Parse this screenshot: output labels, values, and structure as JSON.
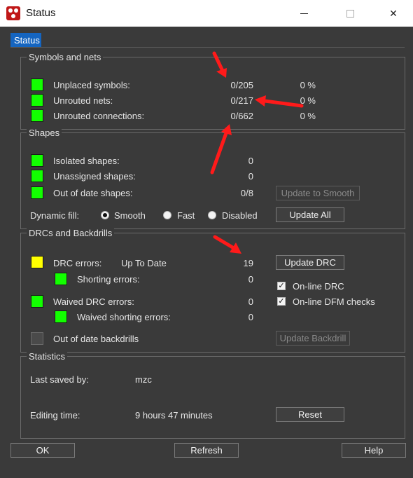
{
  "window": {
    "title": "Status"
  },
  "tabs": [
    {
      "label": "Status"
    }
  ],
  "symbols_and_nets": {
    "title": "Symbols and nets",
    "rows": [
      {
        "label": "Unplaced symbols:",
        "value": "0/205",
        "percent": "0 %"
      },
      {
        "label": "Unrouted nets:",
        "value": "0/217",
        "percent": "0 %"
      },
      {
        "label": "Unrouted connections:",
        "value": "0/662",
        "percent": "0 %"
      }
    ]
  },
  "shapes": {
    "title": "Shapes",
    "rows": [
      {
        "label": "Isolated shapes:",
        "value": "0"
      },
      {
        "label": "Unassigned shapes:",
        "value": "0"
      },
      {
        "label": "Out of date shapes:",
        "value": "0/8"
      }
    ],
    "update_to_smooth": "Update to Smooth",
    "dynamic_fill_label": "Dynamic fill:",
    "fill_options": [
      "Smooth",
      "Fast",
      "Disabled"
    ],
    "fill_selected": "Smooth",
    "update_all": "Update All"
  },
  "drcs": {
    "title": "DRCs and Backdrills",
    "drc_errors_label": "DRC errors:",
    "drc_status": "Up To Date",
    "drc_errors_value": "19",
    "shorting_errors_label": "Shorting errors:",
    "shorting_errors_value": "0",
    "waived_drc_label": "Waived DRC errors:",
    "waived_drc_value": "0",
    "waived_shorting_label": "Waived shorting errors:",
    "waived_shorting_value": "0",
    "out_of_date_backdrills_label": "Out of date backdrills",
    "update_drc": "Update DRC",
    "online_drc": "On-line DRC",
    "online_dfm": "On-line DFM checks",
    "update_backdrill": "Update Backdrill"
  },
  "statistics": {
    "title": "Statistics",
    "last_saved_label": "Last saved by:",
    "last_saved_value": "mzc",
    "editing_time_label": "Editing time:",
    "editing_time_value": "9 hours 47 minutes",
    "reset": "Reset"
  },
  "footer": {
    "ok": "OK",
    "refresh": "Refresh",
    "help": "Help"
  },
  "colors": {
    "ok_status": "#12ff00",
    "warning_status": "#ffff00",
    "annotation_arrow": "#ff1a1a",
    "tab_accent": "#1565c0"
  }
}
